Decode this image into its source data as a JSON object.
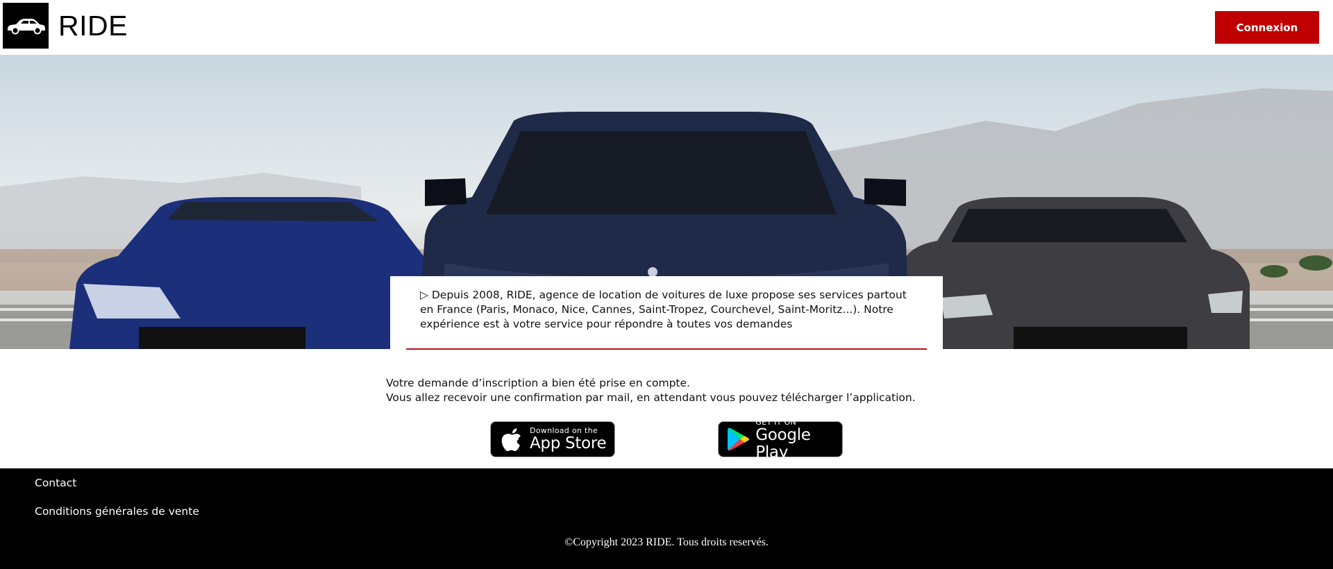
{
  "header": {
    "brand": "RIDE",
    "logo_icon": "car-icon",
    "login_label": "Connexion",
    "login_color": "#c00000"
  },
  "hero": {
    "image": "three luxury cars (Maserati) parked in front of mountains",
    "intro_marker": "▷",
    "intro_text": "Depuis 2008, RIDE, agence de location de voitures de luxe propose ses services partout en France (Paris, Monaco, Nice, Cannes, Saint-Tropez, Courchevel, Saint-Moritz...). Notre expérience est à votre service pour répondre à toutes vos demandes",
    "accent_color": "#b3121d"
  },
  "message": {
    "line1": "Votre demande d’inscription a bien été prise en compte.",
    "line2": "Vous allez recevoir une confirmation par mail, en attendant vous pouvez télécharger l’application."
  },
  "stores": {
    "appstore": {
      "small": "Download on the",
      "big": "App Store",
      "icon": "apple-icon"
    },
    "googleplay": {
      "small": "GET IT ON",
      "big": "Google Play",
      "icon": "google-play-icon"
    }
  },
  "footer": {
    "links": [
      "Contact",
      "Conditions générales de vente"
    ],
    "copyright": "©Copyright 2023 RIDE. Tous droits reservés."
  }
}
